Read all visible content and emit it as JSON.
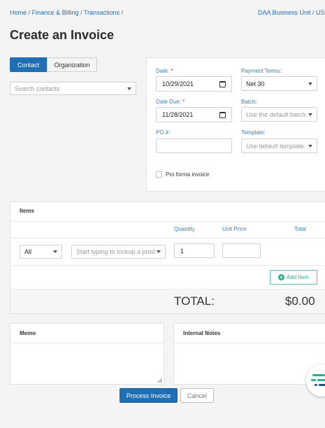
{
  "breadcrumb": {
    "items": [
      "Home",
      "Finance & Billing",
      "Transactions"
    ],
    "sep": "/"
  },
  "business_unit": "DAA Business Unit / USD",
  "page_title": "Create an Invoice",
  "tabs": {
    "contact": "Contact",
    "organization": "Organization"
  },
  "contact_search": {
    "placeholder": "Search contacts"
  },
  "details": {
    "date": {
      "label": "Date:",
      "value": "10/29/2021"
    },
    "payment_terms": {
      "label": "Payment Terms:",
      "value": "Net 30"
    },
    "date_due": {
      "label": "Date Due:",
      "value": "11/28/2021"
    },
    "batch": {
      "label": "Batch:",
      "value": "Use the default batch"
    },
    "po": {
      "label": "PO #:",
      "value": ""
    },
    "template": {
      "label": "Template:",
      "value": "Use default template"
    },
    "pro_forma": {
      "label": "Pro forma invoice",
      "checked": false
    },
    "required_mark": "*"
  },
  "items": {
    "title": "Items",
    "columns": {
      "quantity": "Quantity",
      "unit_price": "Unit Price",
      "total": "Total"
    },
    "row": {
      "type": "All",
      "lookup_placeholder": "Start typing to lookup a prod",
      "quantity": "1",
      "unit_price": ""
    },
    "add_item": "Add Item",
    "total_label": "TOTAL:",
    "total_value": "$0.00"
  },
  "memo": {
    "label": "Memo"
  },
  "internal_notes": {
    "label": "Internal Notes"
  },
  "actions": {
    "process": "Process Invoice",
    "cancel": "Cancel"
  },
  "colors": {
    "primary": "#1f6fb5",
    "accent": "#2bae8f",
    "required": "#d9342b"
  }
}
